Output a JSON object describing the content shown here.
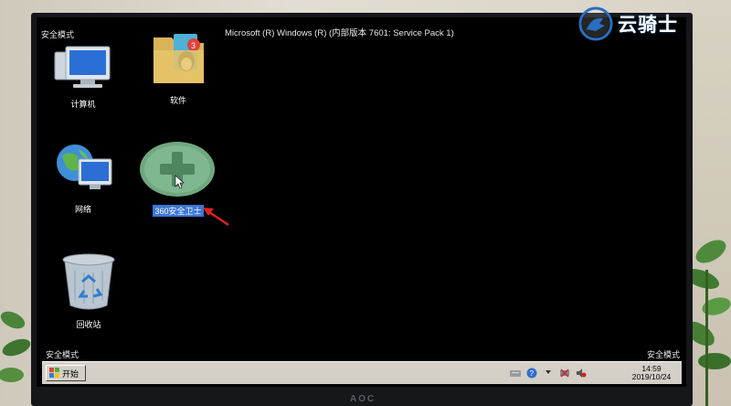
{
  "desktop": {
    "safe_mode_top_left": "安全模式",
    "safe_mode_bottom_left": "安全模式",
    "safe_mode_bottom_right": "安全模式",
    "build_info": "Microsoft (R) Windows (R) (内部版本 7601: Service Pack 1)",
    "icons": [
      {
        "label": "计算机",
        "icon": "computer-icon"
      },
      {
        "label": "软件",
        "icon": "folder-icon"
      },
      {
        "label": "网络",
        "icon": "network-icon"
      },
      {
        "label": "360安全卫士",
        "icon": "360-security-icon",
        "selected": true
      },
      {
        "label": "回收站",
        "icon": "recycle-bin-icon"
      }
    ]
  },
  "taskbar": {
    "start_label": "开始",
    "clock_time": "14:59",
    "clock_date": "2019/10/24"
  },
  "monitor": {
    "brand": "AOC"
  },
  "watermark": {
    "text": "云骑士"
  },
  "colors": {
    "selection": "#3b76d6",
    "taskbar": "#d4d0c8",
    "screen": "#000000",
    "cursor_arrow": "#e02020"
  }
}
